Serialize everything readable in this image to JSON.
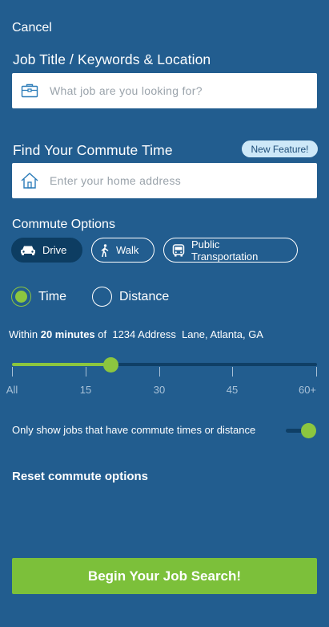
{
  "header": {
    "cancel_label": "Cancel"
  },
  "job_section": {
    "title": "Job Title / Keywords & Location",
    "input_value": "",
    "input_placeholder": "What job are you looking for?",
    "icon": "briefcase-icon"
  },
  "commute_section": {
    "title": "Find Your Commute Time",
    "badge": "New Feature!",
    "input_value": "",
    "input_placeholder": "Enter your home address",
    "icon": "home-icon"
  },
  "commute_options": {
    "title": "Commute Options",
    "modes": [
      {
        "label": "Drive",
        "icon": "car-icon",
        "selected": true
      },
      {
        "label": "Walk",
        "icon": "walk-icon",
        "selected": false
      },
      {
        "label": "Public Transportation",
        "icon": "bus-icon",
        "selected": false
      }
    ]
  },
  "measure": {
    "options": [
      {
        "label": "Time",
        "selected": true
      },
      {
        "label": "Distance",
        "selected": false
      }
    ]
  },
  "within": {
    "prefix": "Within ",
    "amount": "20 minutes",
    "middle": " of  ",
    "address": "1234 Address  Lane, Atlanta, GA"
  },
  "slider": {
    "value_minutes": 20,
    "max_minutes": 60,
    "ticks": [
      "All",
      "15",
      "30",
      "45",
      "60+"
    ]
  },
  "filter": {
    "label": "Only show jobs that have commute times or distance",
    "enabled": true
  },
  "reset_label": "Reset commute options",
  "submit_label": "Begin Your Job Search!",
  "colors": {
    "background": "#225d8f",
    "accent": "#8cc63f",
    "button": "#7cc03a",
    "dark": "#0d3d62"
  }
}
